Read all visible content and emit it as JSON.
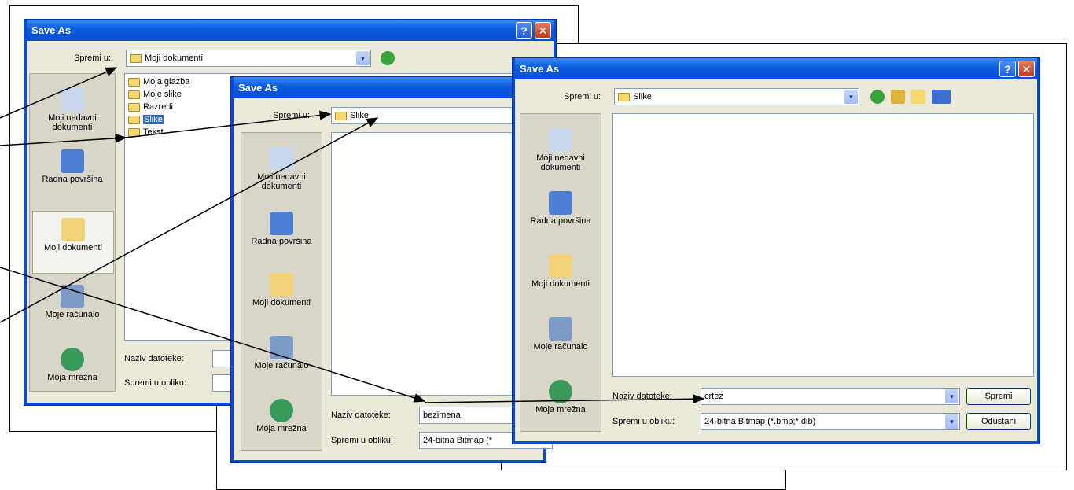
{
  "dialog1": {
    "title": "Save As",
    "save_in_label": "Spremi u:",
    "save_in_value": "Moji dokumenti",
    "places": [
      "Moji nedavni dokumenti",
      "Radna površina",
      "Moji dokumenti",
      "Moje računalo",
      "Moja mrežna"
    ],
    "items": [
      "Moja glazba",
      "Moje slike",
      "Razredi",
      "Slike",
      "Tekst"
    ],
    "filename_label": "Naziv datoteke:",
    "filetype_label": "Spremi u obliku:"
  },
  "dialog2": {
    "title": "Save As",
    "save_in_label": "Spremi u:",
    "save_in_value": "Slike",
    "places": [
      "Moji nedavni dokumenti",
      "Radna površina",
      "Moji dokumenti",
      "Moje računalo",
      "Moja mrežna"
    ],
    "filename_label": "Naziv datoteke:",
    "filename_value": "bezimena",
    "filetype_label": "Spremi u obliku:",
    "filetype_value": "24-bitna Bitmap (*"
  },
  "dialog3": {
    "title": "Save As",
    "save_in_label": "Spremi u:",
    "save_in_value": "Slike",
    "places": [
      "Moji nedavni dokumenti",
      "Radna površina",
      "Moji dokumenti",
      "Moje računalo",
      "Moja mrežna"
    ],
    "filename_label": "Naziv datoteke:",
    "filename_value": "crtez",
    "filetype_label": "Spremi u obliku:",
    "filetype_value": "24-bitna Bitmap (*.bmp;*.dib)",
    "save_button": "Spremi",
    "cancel_button": "Odustani"
  },
  "colors": {
    "title_blue": "#0a5adf",
    "dialog_face": "#ece9d8",
    "selection": "#316ac5"
  }
}
